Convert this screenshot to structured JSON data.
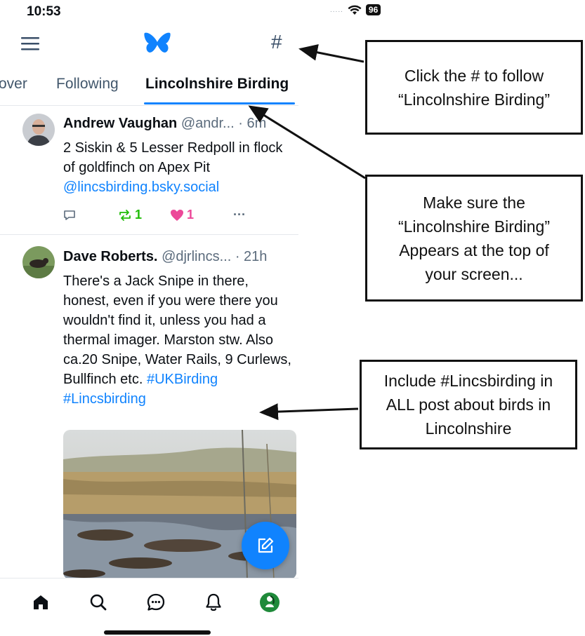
{
  "status_bar": {
    "time": "10:53",
    "signal": ".....",
    "battery": "96"
  },
  "header": {
    "hash_label": "#"
  },
  "tabs": [
    {
      "label": "over"
    },
    {
      "label": "Following"
    },
    {
      "label": "Lincolnshire Birding"
    }
  ],
  "posts": [
    {
      "author": "Andrew Vaughan",
      "handle": "@andr...",
      "time": "· 6m",
      "text": "2 Siskin & 5 Lesser Redpoll in flock of goldfinch on Apex Pit",
      "link": "@lincsbirding.bsky.social",
      "reposts": "1",
      "likes": "1",
      "more": "···"
    },
    {
      "author": "Dave Roberts.",
      "handle": "@djrlincs...",
      "time": "· 21h",
      "text": "There's a Jack Snipe in there, honest, even if you were there you wouldn't find it, unless you had a thermal imager. Marston stw. Also ca.20 Snipe, Water Rails, 9 Curlews, Bullfinch etc.",
      "tags": "#UKBirding #Lincsbirding"
    }
  ],
  "callouts": {
    "follow": "Click the # to follow “Lincolnshire Birding”",
    "top": "Make sure the “Lincolnshire Birding” Appears at the top of your screen...",
    "hashtag": "Include #Lincsbirding in ALL post about birds in Lincolnshire"
  },
  "colors": {
    "accent": "#1083fe",
    "repost": "#20bc07",
    "like": "#ec4899"
  }
}
